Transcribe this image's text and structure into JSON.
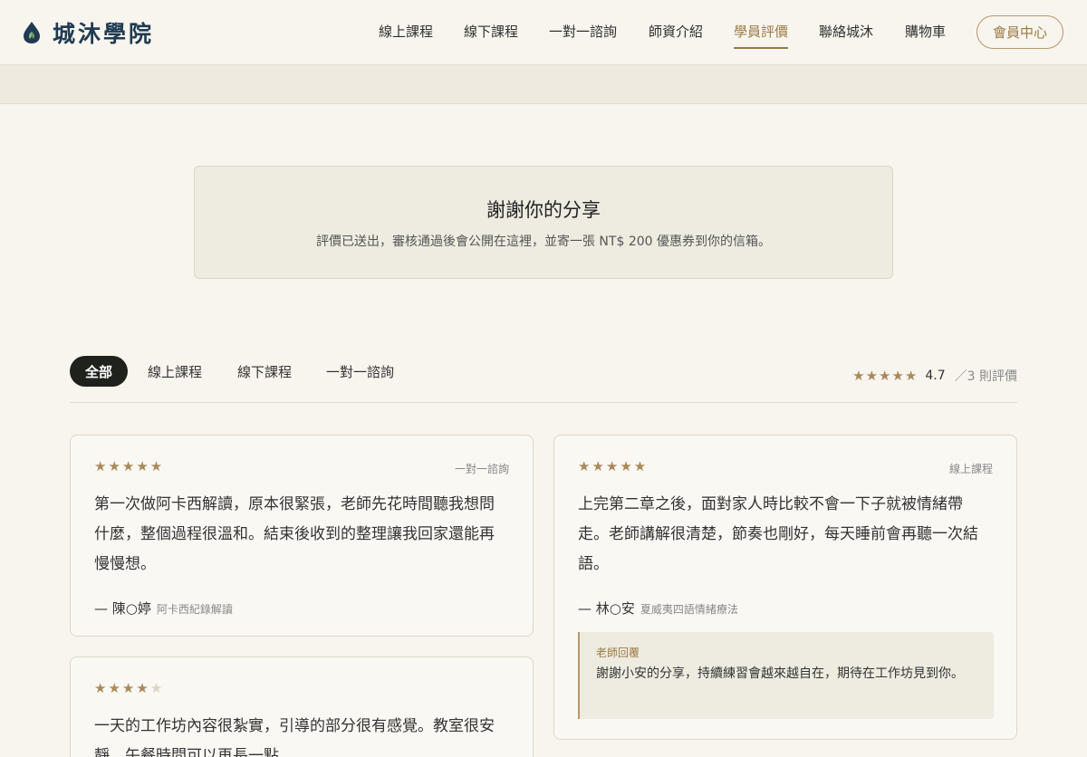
{
  "site": {
    "name": "城沐學院"
  },
  "nav": {
    "items": [
      "線上課程",
      "線下課程",
      "一對一諮詢",
      "師資介紹",
      "學員評價",
      "聯絡城沐",
      "購物車"
    ],
    "active": "學員評價",
    "member_button": "會員中心"
  },
  "thanks": {
    "title": "謝謝你的分享",
    "message": "評價已送出，審核通過後會公開在這裡，並寄一張 NT$ 200 優惠券到你的信箱。"
  },
  "filters": {
    "tabs": [
      "全部",
      "線上課程",
      "線下課程",
      "一對一諮詢"
    ],
    "active": "全部"
  },
  "summary": {
    "stars": "★★★★★",
    "score": "4.7",
    "count_text": "／3 則評價",
    "rating": 4.7
  },
  "reviews": [
    {
      "rating": 5,
      "stars": "★★★★★",
      "category": "一對一諮詢",
      "text": "第一次做阿卡西解讀，原本很緊張，老師先花時間聽我想問什麼，整個過程很溫和。結束後收到的整理讓我回家還能再慢慢想。",
      "author": "— 陳○婷",
      "course": "阿卡西紀錄解讀"
    },
    {
      "rating": 5,
      "stars": "★★★★★",
      "category": "線上課程",
      "text": "上完第二章之後，面對家人時比較不會一下子就被情緒帶走。老師講解很清楚，節奏也剛好，每天睡前會再聽一次結語。",
      "author": "— 林○安",
      "course": "夏威夷四語情緒療法",
      "reply": {
        "label": "老師回覆",
        "text": "謝謝小安的分享，持續練習會越來越自在，期待在工作坊見到你。"
      }
    },
    {
      "rating": 4,
      "stars_on": "★★★★",
      "stars_off": "★",
      "text": "一天的工作坊內容很紮實，引導的部分很有感覺。教室很安靜，午餐時間可以再長一點。"
    }
  ],
  "colors": {
    "accent": "#9a7a45",
    "brand": "#1f3a52",
    "background": "#f8f5ee",
    "panel": "#eeebe1"
  }
}
